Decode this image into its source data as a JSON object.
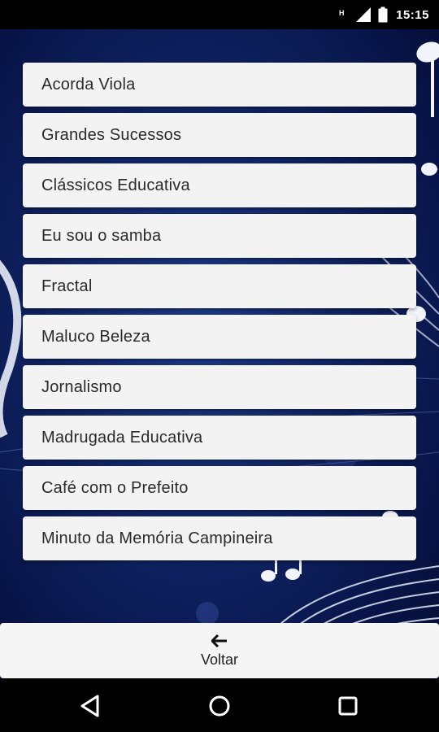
{
  "status_bar": {
    "time": "15:15",
    "icons": [
      "network-h-icon",
      "signal-icon",
      "battery-icon"
    ]
  },
  "menu": {
    "items": [
      {
        "label": "Acorda Viola"
      },
      {
        "label": "Grandes Sucessos"
      },
      {
        "label": "Clássicos Educativa"
      },
      {
        "label": "Eu sou o samba"
      },
      {
        "label": "Fractal"
      },
      {
        "label": "Maluco Beleza"
      },
      {
        "label": "Jornalismo"
      },
      {
        "label": "Madrugada Educativa"
      },
      {
        "label": "Café com o Prefeito"
      },
      {
        "label": "Minuto da Memória Campineira"
      }
    ]
  },
  "back_button": {
    "icon": "arrow-left-icon",
    "label": "Voltar"
  },
  "nav_bar": {
    "icons": [
      "nav-back-icon",
      "nav-home-icon",
      "nav-recent-icon"
    ]
  },
  "colors": {
    "background": "#0f2362",
    "item_background": "#f3f3f3",
    "text": "#2a2a2a"
  }
}
